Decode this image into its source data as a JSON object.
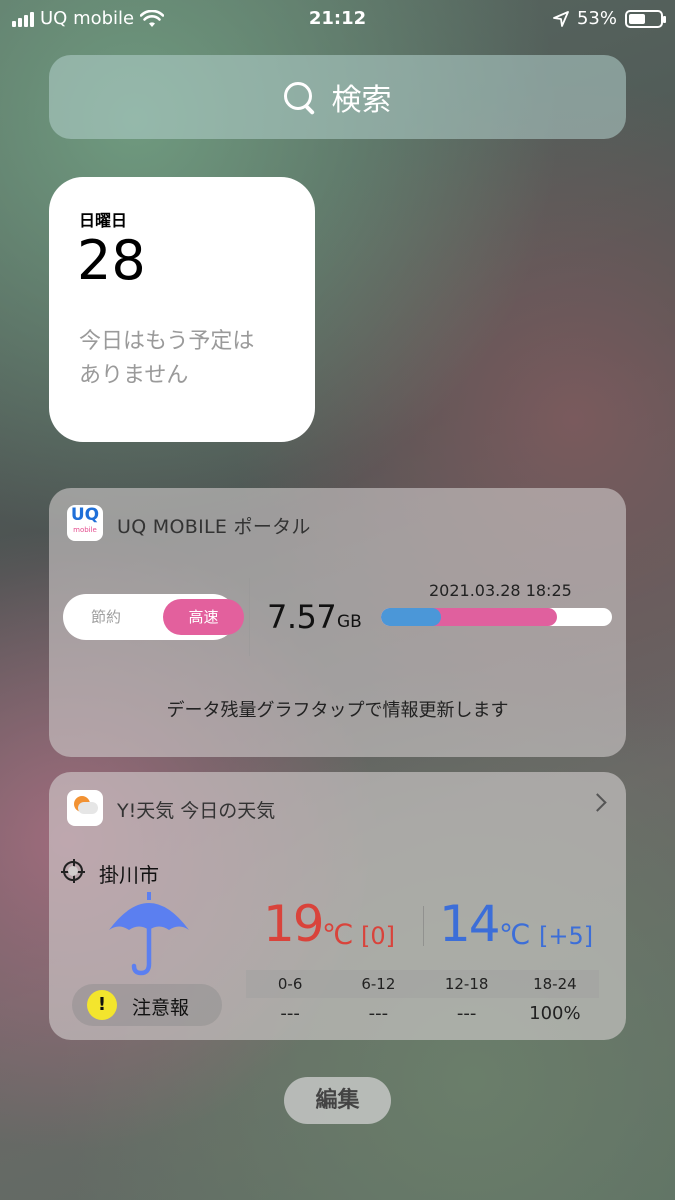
{
  "status_bar": {
    "carrier": "UQ mobile",
    "time": "21:12",
    "battery_percent": "53%",
    "battery_level": 0.53
  },
  "search": {
    "label": "検索"
  },
  "calendar_widget": {
    "weekday": "日曜日",
    "date": "28",
    "message_line1": "今日はもう予定は",
    "message_line2": "ありません"
  },
  "uq_widget": {
    "logo_text": "UQ",
    "logo_subtext": "mobile",
    "title": "UQ MOBILE ポータル",
    "toggle_off_label": "節約",
    "toggle_on_label": "高速",
    "data_value": "7.57",
    "data_unit": "GB",
    "updated_at": "2021.03.28 18:25",
    "bar_blue_fraction": 0.26,
    "bar_pink_fraction": 0.76,
    "hint": "データ残量グラフタップで情報更新します",
    "colors": {
      "pink": "#e0609e",
      "blue": "#4b97d8"
    }
  },
  "weather_widget": {
    "title": "Y!天気 今日の天気",
    "location": "掛川市",
    "high_temp": "19",
    "high_unit": "℃",
    "high_diff": "[0]",
    "low_temp": "14",
    "low_unit": "℃",
    "low_diff": "[+5]",
    "rain_periods": [
      "0-6",
      "6-12",
      "12-18",
      "18-24"
    ],
    "rain_values": [
      "---",
      "---",
      "---",
      "100%"
    ],
    "alert_label": "注意報",
    "alert_mark": "!",
    "weather_icon": "umbrella-icon",
    "colors": {
      "high": "#d9433b",
      "low": "#3c6ed8",
      "umbrella": "#5b7ff0"
    }
  },
  "edit_button": {
    "label": "編集"
  }
}
